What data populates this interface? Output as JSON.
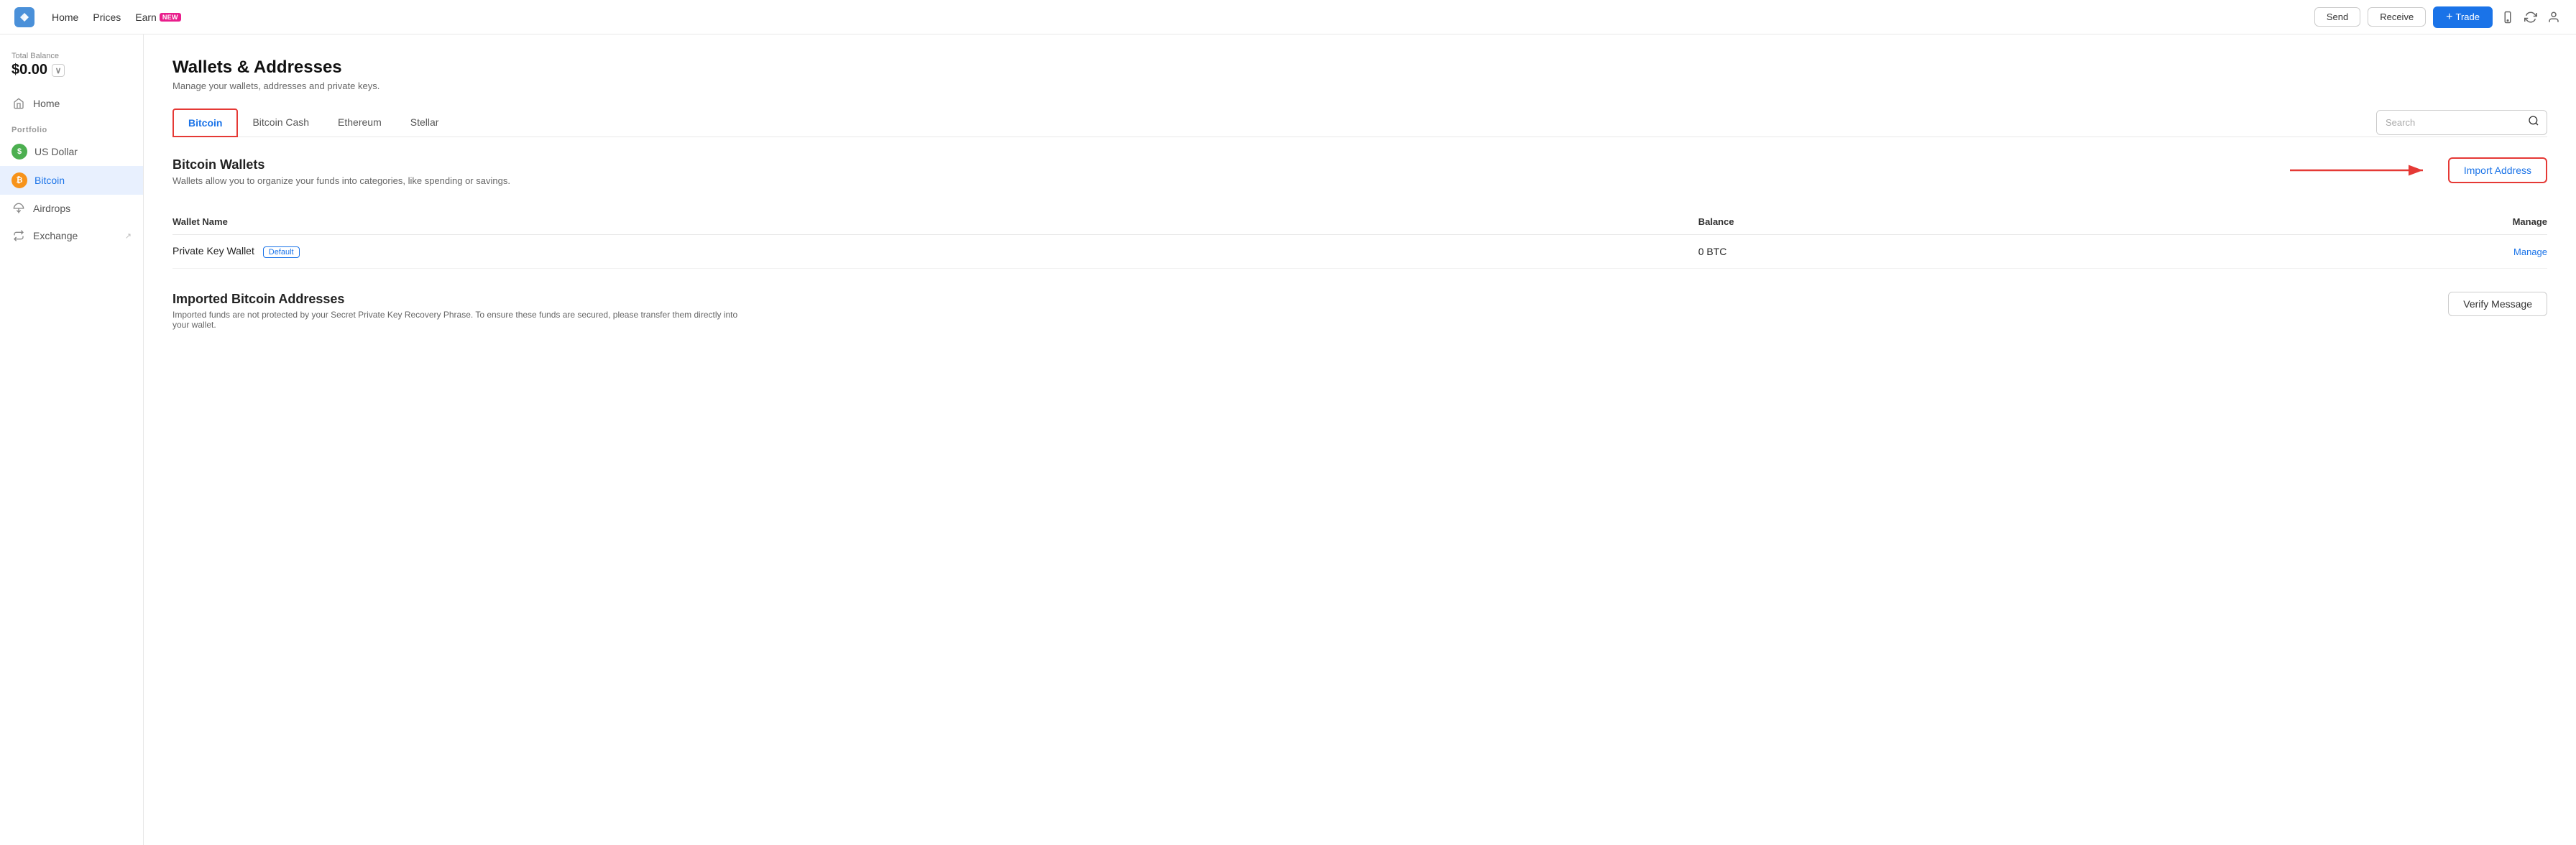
{
  "topnav": {
    "logo_alt": "App Logo",
    "nav_home": "Home",
    "nav_prices": "Prices",
    "nav_earn": "Earn",
    "earn_badge": "NEW",
    "btn_send": "Send",
    "btn_receive": "Receive",
    "btn_trade": "Trade"
  },
  "sidebar": {
    "balance_label": "Total Balance",
    "balance_value": "$0.00",
    "nav_home": "Home",
    "section_portfolio": "Portfolio",
    "item_us_dollar": "US Dollar",
    "item_bitcoin": "Bitcoin",
    "item_airdrops": "Airdrops",
    "item_exchange": "Exchange"
  },
  "page": {
    "title": "Wallets & Addresses",
    "subtitle": "Manage your wallets, addresses and private keys."
  },
  "tabs": [
    {
      "label": "Bitcoin",
      "active": true
    },
    {
      "label": "Bitcoin Cash",
      "active": false
    },
    {
      "label": "Ethereum",
      "active": false
    },
    {
      "label": "Stellar",
      "active": false
    }
  ],
  "search": {
    "placeholder": "Search"
  },
  "wallets_section": {
    "title": "Bitcoin Wallets",
    "subtitle": "Wallets allow you to organize your funds into categories, like spending or savings.",
    "import_btn": "Import Address",
    "table_headers": {
      "wallet_name": "Wallet Name",
      "balance": "Balance",
      "manage": "Manage"
    },
    "rows": [
      {
        "name": "Private Key Wallet",
        "badge": "Default",
        "balance": "0 BTC",
        "manage_link": "Manage"
      }
    ]
  },
  "imported_section": {
    "title": "Imported Bitcoin Addresses",
    "subtitle": "Imported funds are not protected by your Secret Private Key Recovery Phrase. To ensure these funds are secured, please transfer them directly into your wallet.",
    "verify_btn": "Verify Message"
  }
}
